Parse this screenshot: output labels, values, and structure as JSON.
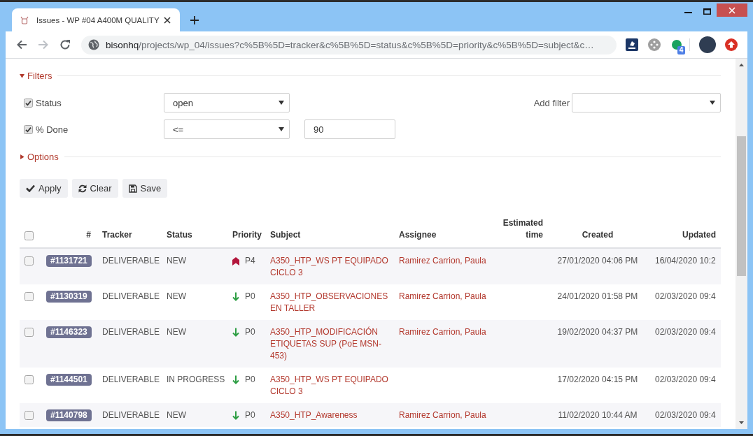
{
  "browser": {
    "tabs": [
      {
        "title": "Issues - WP #04 A400M QUALITY",
        "selected": true
      }
    ],
    "nav_buttons": [
      {
        "kind": "back",
        "disabled": false
      },
      {
        "kind": "forward",
        "disabled": true
      },
      {
        "kind": "reload",
        "disabled": false
      }
    ],
    "url": {
      "host": "bisonhq",
      "path": "/projects/wp_04/issues?c%5B%5D=tracker&c%5B%5D=status&c%5B%5D=priority&c%5B%5D=subject&c…"
    },
    "extension_badge": "4"
  },
  "filters": {
    "label": "Filters",
    "expanded": true,
    "rows": [
      {
        "label": "Status",
        "checked": true,
        "operator": "open"
      },
      {
        "label": "% Done",
        "checked": true,
        "operator": "<=",
        "value": "90"
      }
    ],
    "add_filter_label": "Add filter"
  },
  "options": {
    "label": "Options",
    "expanded": false
  },
  "buttons": [
    {
      "kind": "apply",
      "label": "Apply"
    },
    {
      "kind": "clear",
      "label": "Clear"
    },
    {
      "kind": "save",
      "label": "Save"
    }
  ],
  "table": {
    "header_checkbox": {
      "checked": false
    },
    "columns": [
      "#",
      "Tracker",
      "Status",
      "Priority",
      "Subject",
      "Assignee",
      "Estimated time",
      "Created",
      "Updated"
    ],
    "rows": [
      {
        "checked": false,
        "id": "#1131721",
        "tracker": "DELIVERABLE",
        "status": "NEW",
        "priority": {
          "label": "P4",
          "kind": "high"
        },
        "subject": "A350_HTP_WS PT EQUIPADO CICLO 3",
        "assignee": "Ramirez Carrion, Paula",
        "created": "27/01/2020 04:06 PM",
        "updated": "16/04/2020 10:2"
      },
      {
        "checked": false,
        "id": "#1130319",
        "tracker": "DELIVERABLE",
        "status": "NEW",
        "priority": {
          "label": "P0",
          "kind": "low"
        },
        "subject": "A350_HTP_OBSERVACIONES EN TALLER",
        "assignee": "Ramirez Carrion, Paula",
        "created": "24/01/2020 01:58 PM",
        "updated": "02/03/2020 09:4"
      },
      {
        "checked": false,
        "id": "#1146323",
        "tracker": "DELIVERABLE",
        "status": "NEW",
        "priority": {
          "label": "P0",
          "kind": "low"
        },
        "subject": "A350_HTP_MODIFICACIÓN ETIQUETAS SUP (PoE MSN-453)",
        "assignee": "Ramirez Carrion, Paula",
        "created": "19/02/2020 04:37 PM",
        "updated": "02/03/2020 09:4"
      },
      {
        "checked": false,
        "id": "#1144501",
        "tracker": "DELIVERABLE",
        "status": "IN PROGRESS",
        "priority": {
          "label": "P0",
          "kind": "low"
        },
        "subject": "A350_HTP_WS PT EQUIPADO CICLO 3",
        "created": "17/02/2020 04:15 PM",
        "updated": "02/03/2020 09:4"
      },
      {
        "checked": false,
        "id": "#1140798",
        "tracker": "DELIVERABLE",
        "status": "NEW",
        "priority": {
          "label": "P0",
          "kind": "low"
        },
        "subject": "A350_HTP_Awareness",
        "assignee": "Ramirez Carrion, Paula",
        "created": "11/02/2020 10:44 AM",
        "updated": "02/03/2020 09:4"
      }
    ]
  }
}
